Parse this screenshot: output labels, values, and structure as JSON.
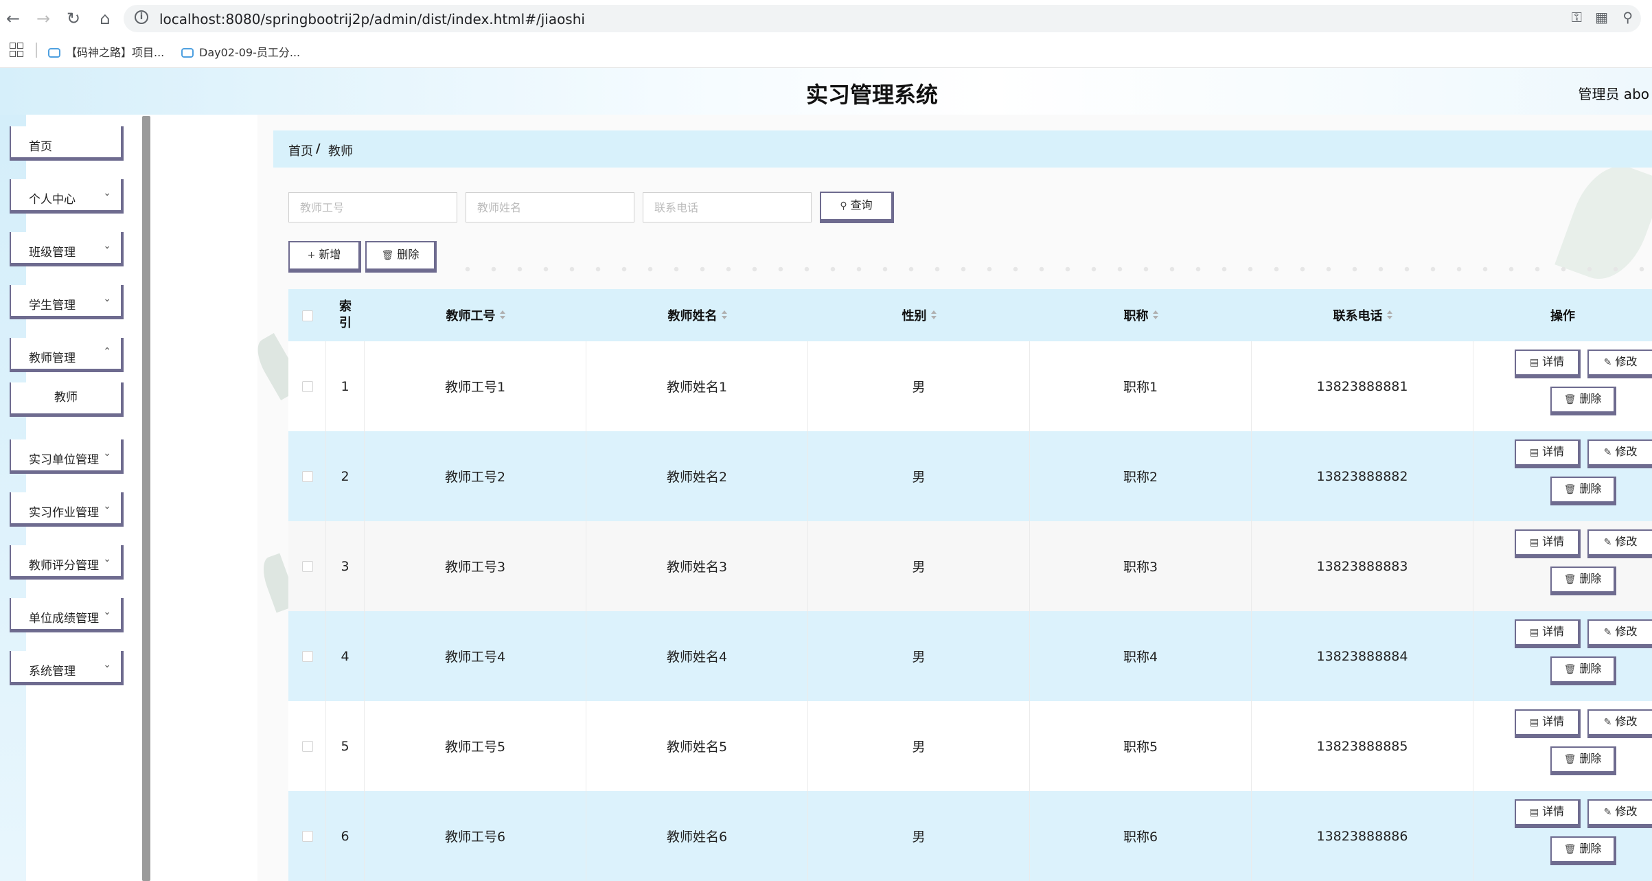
{
  "browser": {
    "url": "localhost:8080/springbootrij2p/admin/dist/index.html#/jiaoshi",
    "bookmarks": [
      "【码神之路】项目...",
      "Day02-09-员工分..."
    ]
  },
  "header": {
    "title": "实习管理系统",
    "user": "管理员 abo"
  },
  "sidebar": {
    "items": [
      {
        "label": "首页"
      },
      {
        "label": "个人中心"
      },
      {
        "label": "班级管理"
      },
      {
        "label": "学生管理"
      },
      {
        "label": "教师管理"
      },
      {
        "label": "教师"
      },
      {
        "label": "实习单位管理"
      },
      {
        "label": "实习作业管理"
      },
      {
        "label": "教师评分管理"
      },
      {
        "label": "单位成绩管理"
      },
      {
        "label": "系统管理"
      }
    ]
  },
  "breadcrumb": {
    "home": "首页",
    "sep": "/",
    "current": "教师"
  },
  "search": {
    "teacher_no_placeholder": "教师工号",
    "teacher_name_placeholder": "教师姓名",
    "phone_placeholder": "联系电话",
    "query_label": "查询"
  },
  "actions": {
    "add_label": "新增",
    "delete_label": "删除"
  },
  "table": {
    "headers": {
      "index": "索引",
      "teacher_no": "教师工号",
      "teacher_name": "教师姓名",
      "gender": "性别",
      "title": "职称",
      "phone": "联系电话",
      "ops": "操作"
    },
    "op_labels": {
      "detail": "详情",
      "edit": "修改",
      "delete": "删除"
    },
    "rows": [
      {
        "index": "1",
        "teacher_no": "教师工号1",
        "teacher_name": "教师姓名1",
        "gender": "男",
        "title": "职称1",
        "phone": "13823888881"
      },
      {
        "index": "2",
        "teacher_no": "教师工号2",
        "teacher_name": "教师姓名2",
        "gender": "男",
        "title": "职称2",
        "phone": "13823888882"
      },
      {
        "index": "3",
        "teacher_no": "教师工号3",
        "teacher_name": "教师姓名3",
        "gender": "男",
        "title": "职称3",
        "phone": "13823888883"
      },
      {
        "index": "4",
        "teacher_no": "教师工号4",
        "teacher_name": "教师姓名4",
        "gender": "男",
        "title": "职称4",
        "phone": "13823888884"
      },
      {
        "index": "5",
        "teacher_no": "教师工号5",
        "teacher_name": "教师姓名5",
        "gender": "男",
        "title": "职称5",
        "phone": "13823888885"
      },
      {
        "index": "6",
        "teacher_no": "教师工号6",
        "teacher_name": "教师姓名6",
        "gender": "男",
        "title": "职称6",
        "phone": "13823888886"
      }
    ]
  }
}
